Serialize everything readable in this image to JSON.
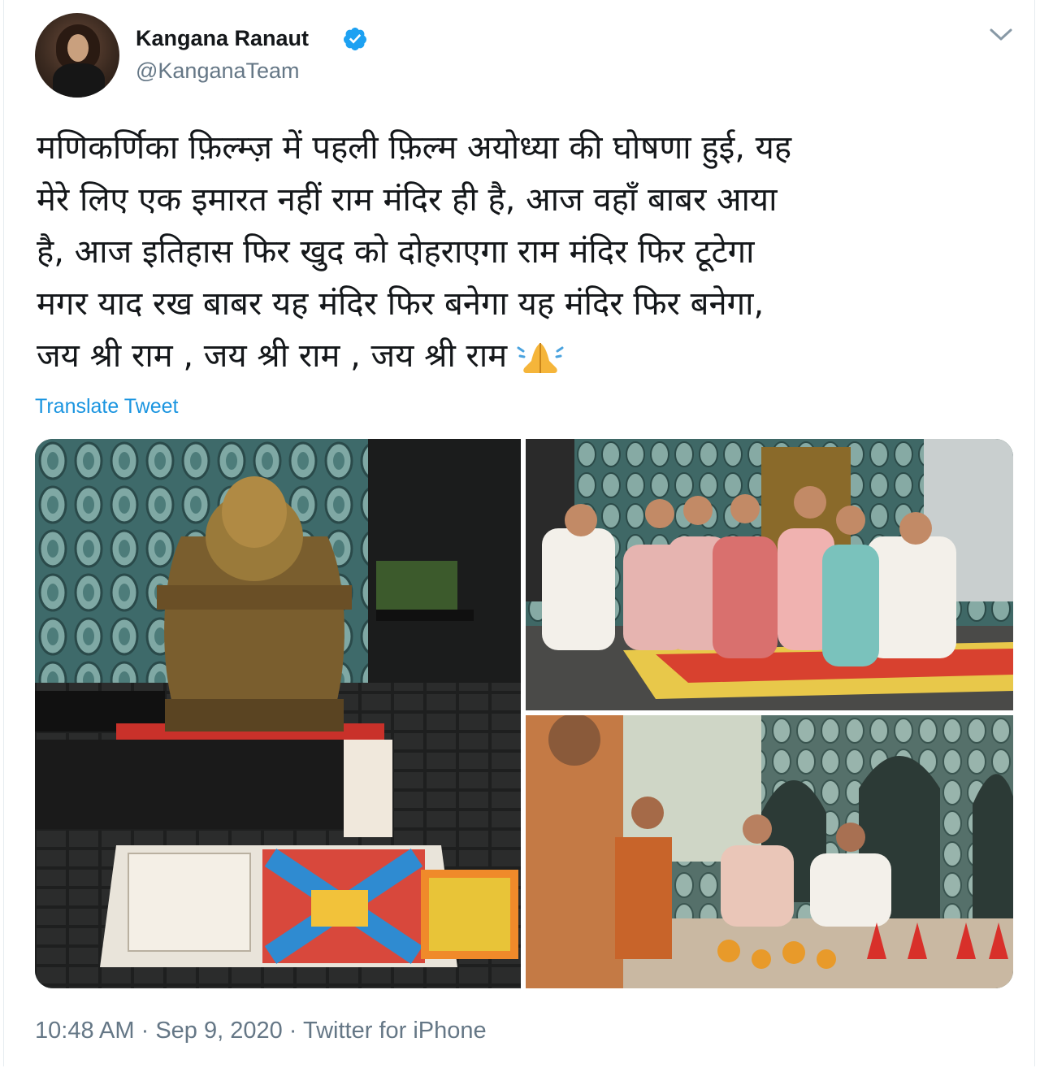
{
  "author": {
    "name": "Kangana Ranaut",
    "handle": "@KanganaTeam",
    "verified": true
  },
  "tweet": {
    "lines": [
      "मणिकर्णिका फ़िल्म्ज़ में पहली फ़िल्म अयोध्या की घोषणा हुई, यह",
      "मेरे लिए एक इमारत नहीं राम मंदिर ही है, आज वहाँ बाबर आया",
      "है, आज इतिहास फिर खुद को दोहराएगा राम मंदिर फिर टूटेगा",
      "मगर याद रख बाबर यह मंदिर फिर बनेगा यह मंदिर फिर बनेगा,",
      "जय श्री राम , जय श्री राम , जय श्री राम"
    ],
    "translate_label": "Translate Tweet"
  },
  "meta": {
    "time": "10:48 AM",
    "date": "Sep 9, 2020",
    "source": "Twitter for iPhone",
    "separator": " · "
  },
  "icons": {
    "verified": "verified-badge-icon",
    "chevron": "chevron-down-icon",
    "emoji": "folded-hands-emoji"
  },
  "colors": {
    "link": "#1b95e0",
    "secondary": "#657786",
    "verified": "#1da1f2"
  }
}
